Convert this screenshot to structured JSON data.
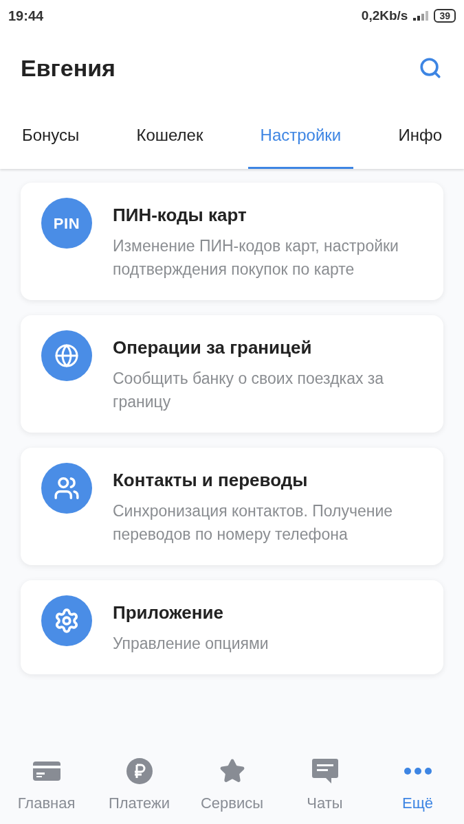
{
  "status_bar": {
    "time": "19:44",
    "speed": "0,2Kb/s",
    "battery": "39"
  },
  "header": {
    "title": "Евгения"
  },
  "tabs": [
    {
      "label": "Бонусы",
      "selected": false
    },
    {
      "label": "Кошелек",
      "selected": false
    },
    {
      "label": "Настройки",
      "selected": true
    },
    {
      "label": "Инфо",
      "selected": false
    }
  ],
  "cards": [
    {
      "kind": "pin",
      "icon_text": "PIN",
      "title": "ПИН-коды карт",
      "subtitle": "Изменение ПИН-кодов карт, настройки подтверждения покупок по карте"
    },
    {
      "kind": "globe",
      "title": "Операции за границей",
      "subtitle": "Сообщить банку о своих поездках за границу"
    },
    {
      "kind": "contacts",
      "title": "Контакты и переводы",
      "subtitle": "Синхронизация контактов. Получение переводов по номеру телефона"
    },
    {
      "kind": "gear",
      "title": "Приложение",
      "subtitle": "Управление опциями"
    }
  ],
  "bottom_nav": [
    {
      "kind": "card",
      "label": "Главная",
      "selected": false
    },
    {
      "kind": "ruble",
      "label": "Платежи",
      "selected": false
    },
    {
      "kind": "star",
      "label": "Сервисы",
      "selected": false
    },
    {
      "kind": "chat",
      "label": "Чаты",
      "selected": false
    },
    {
      "kind": "more",
      "label": "Ещё",
      "selected": true
    }
  ]
}
